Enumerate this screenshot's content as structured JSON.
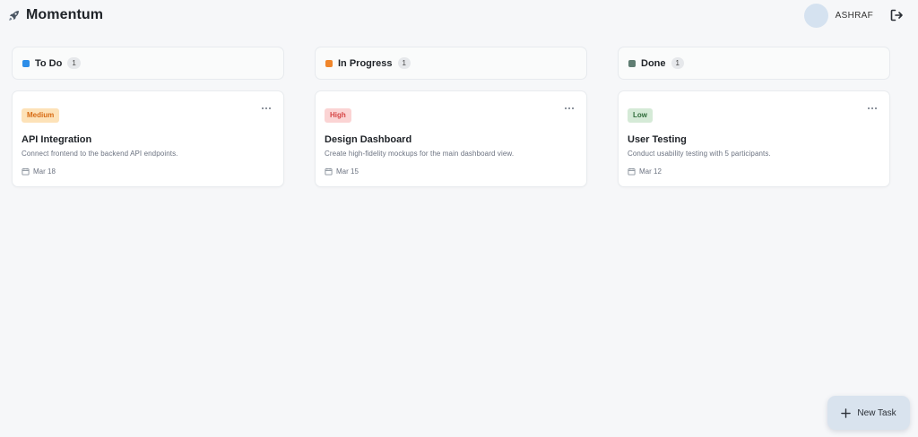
{
  "app": {
    "title": "Momentum"
  },
  "user": {
    "name": "ASHRAF"
  },
  "colors": {
    "todo": "#2d8ee8",
    "in_progress": "#f0862b",
    "done": "#5f7d72",
    "medium_bg": "#fde2b8",
    "medium_fg": "#d76a12",
    "high_bg": "#fbd4d4",
    "high_fg": "#d64545",
    "low_bg": "#d5ead7",
    "low_fg": "#2f6b3a"
  },
  "columns": [
    {
      "title": "To Do",
      "count": "1",
      "cards": [
        {
          "priority": "Medium",
          "title": "API Integration",
          "description": "Connect frontend to the backend API endpoints.",
          "date": "Mar 18"
        }
      ]
    },
    {
      "title": "In Progress",
      "count": "1",
      "cards": [
        {
          "priority": "High",
          "title": "Design Dashboard",
          "description": "Create high-fidelity mockups for the main dashboard view.",
          "date": "Mar 15"
        }
      ]
    },
    {
      "title": "Done",
      "count": "1",
      "cards": [
        {
          "priority": "Low",
          "title": "User Testing",
          "description": "Conduct usability testing with 5 participants.",
          "date": "Mar 12"
        }
      ]
    }
  ],
  "fab": {
    "label": "New Task"
  },
  "icons": {
    "brand": "rocket-icon",
    "logout": "logout-icon",
    "more": "more-horizontal-icon",
    "date": "calendar-icon",
    "add": "plus-icon"
  }
}
